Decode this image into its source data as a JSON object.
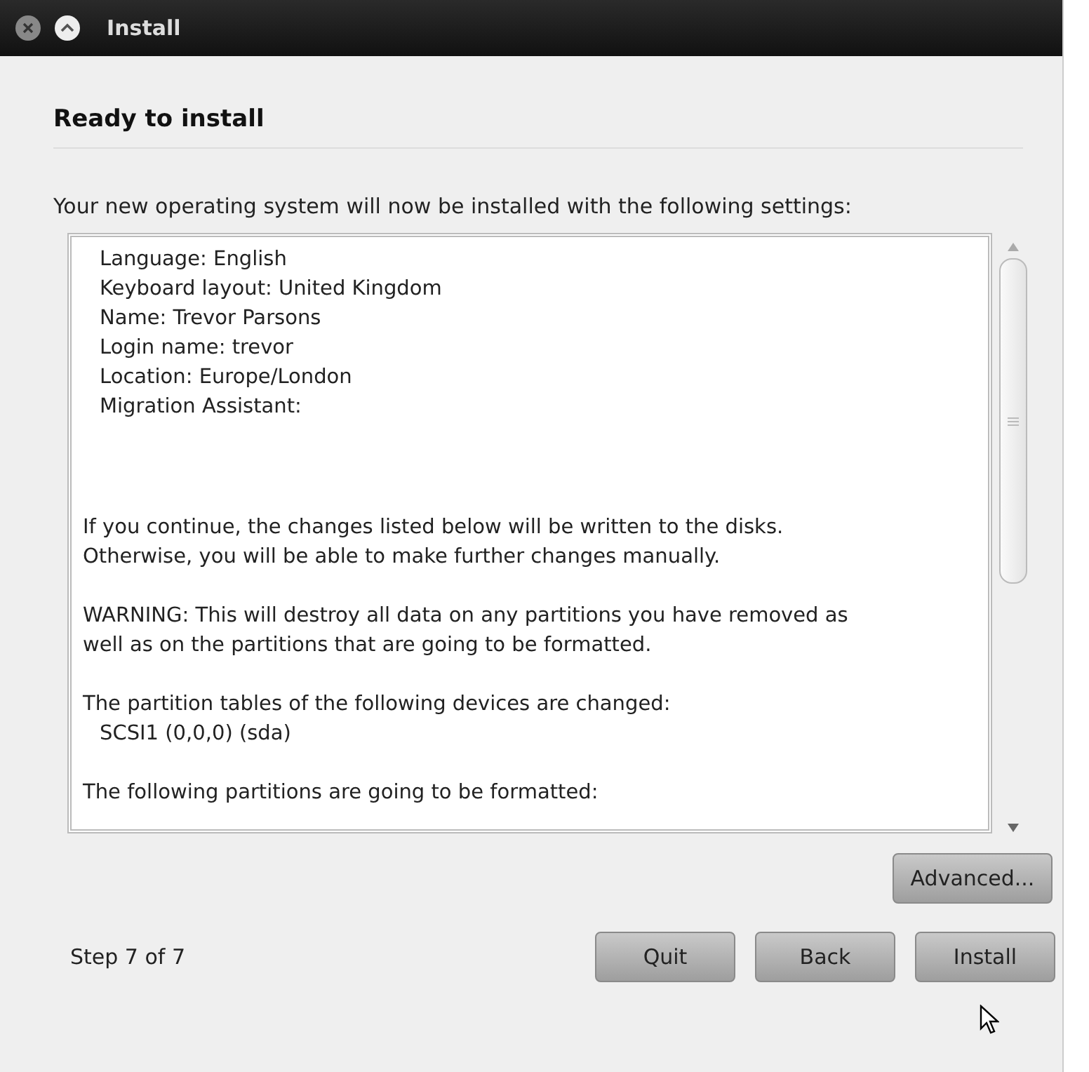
{
  "window": {
    "title": "Install"
  },
  "heading": "Ready to install",
  "description": "Your new operating system will now be installed with the following settings:",
  "summary": {
    "blocks": [
      {
        "lines": [
          {
            "text": "Language: English",
            "indented": true
          },
          {
            "text": "Keyboard layout: United Kingdom",
            "indented": true
          },
          {
            "text": "Name: Trevor Parsons",
            "indented": true
          },
          {
            "text": "Login name: trevor",
            "indented": true
          },
          {
            "text": "Location: Europe/London",
            "indented": true
          },
          {
            "text": "Migration Assistant:",
            "indented": true
          }
        ]
      },
      {
        "lines": [
          {
            "text": "If you continue, the changes listed below will be written to the disks.\nOtherwise, you will be able to make further changes manually.",
            "indented": false
          }
        ]
      },
      {
        "lines": [
          {
            "text": "WARNING: This will destroy all data on any partitions you have removed as\nwell as on the partitions that are going to be formatted.",
            "indented": false
          }
        ]
      },
      {
        "lines": [
          {
            "text": "The partition tables of the following devices are changed:",
            "indented": false
          },
          {
            "text": "SCSI1 (0,0,0) (sda)",
            "indented": true
          }
        ]
      },
      {
        "lines": [
          {
            "text": "The following partitions are going to be formatted:",
            "indented": false
          }
        ]
      }
    ]
  },
  "advanced_button": "Advanced...",
  "step": "Step 7 of 7",
  "buttons": [
    "Quit",
    "Back",
    "Install"
  ]
}
